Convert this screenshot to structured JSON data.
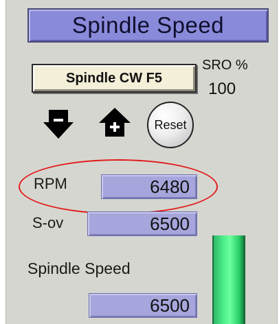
{
  "header": {
    "title": "Spindle Speed"
  },
  "controls": {
    "spindle_button": "Spindle CW F5",
    "sro_label": "SRO %",
    "sro_value": "100",
    "reset_button": "Reset",
    "down_icon": "minus-down-arrow-icon",
    "home_icon": "plus-home-arrow-icon"
  },
  "readouts": {
    "rpm": {
      "label": "RPM",
      "value": "6480"
    },
    "s_ov": {
      "label": "S-ov",
      "value": "6500"
    },
    "spindle_speed": {
      "label": "Spindle Speed",
      "value": "6500"
    }
  },
  "gauge": {
    "fill_fraction": 1.0,
    "color": "#4ef08c"
  },
  "colors": {
    "title_bg": "#8a8adb",
    "readout_bg": "#a6a6dc",
    "highlight": "#e21a1a",
    "panel": "#d6d6d0"
  }
}
